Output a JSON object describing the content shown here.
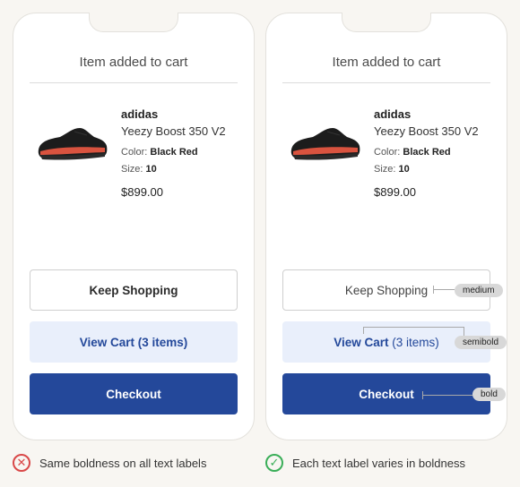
{
  "screen": {
    "title": "Item added to cart",
    "product": {
      "brand": "adidas",
      "name": "Yeezy Boost 350 V2",
      "color_label": "Color:",
      "color_value": "Black Red",
      "size_label": "Size:",
      "size_value": "10",
      "price": "$899.00"
    },
    "buttons": {
      "keep": "Keep Shopping",
      "view_word": "View Cart",
      "view_count": "(3 items)",
      "checkout": "Checkout"
    }
  },
  "annotations": {
    "medium": "medium",
    "semibold": "semibold",
    "bold": "bold"
  },
  "captions": {
    "bad": "Same boldness on all text labels",
    "good": "Each text label varies in boldness"
  },
  "colors": {
    "primary": "#24489a",
    "secondary_bg": "#e9effb",
    "bad": "#d94848",
    "good": "#3aae58"
  }
}
